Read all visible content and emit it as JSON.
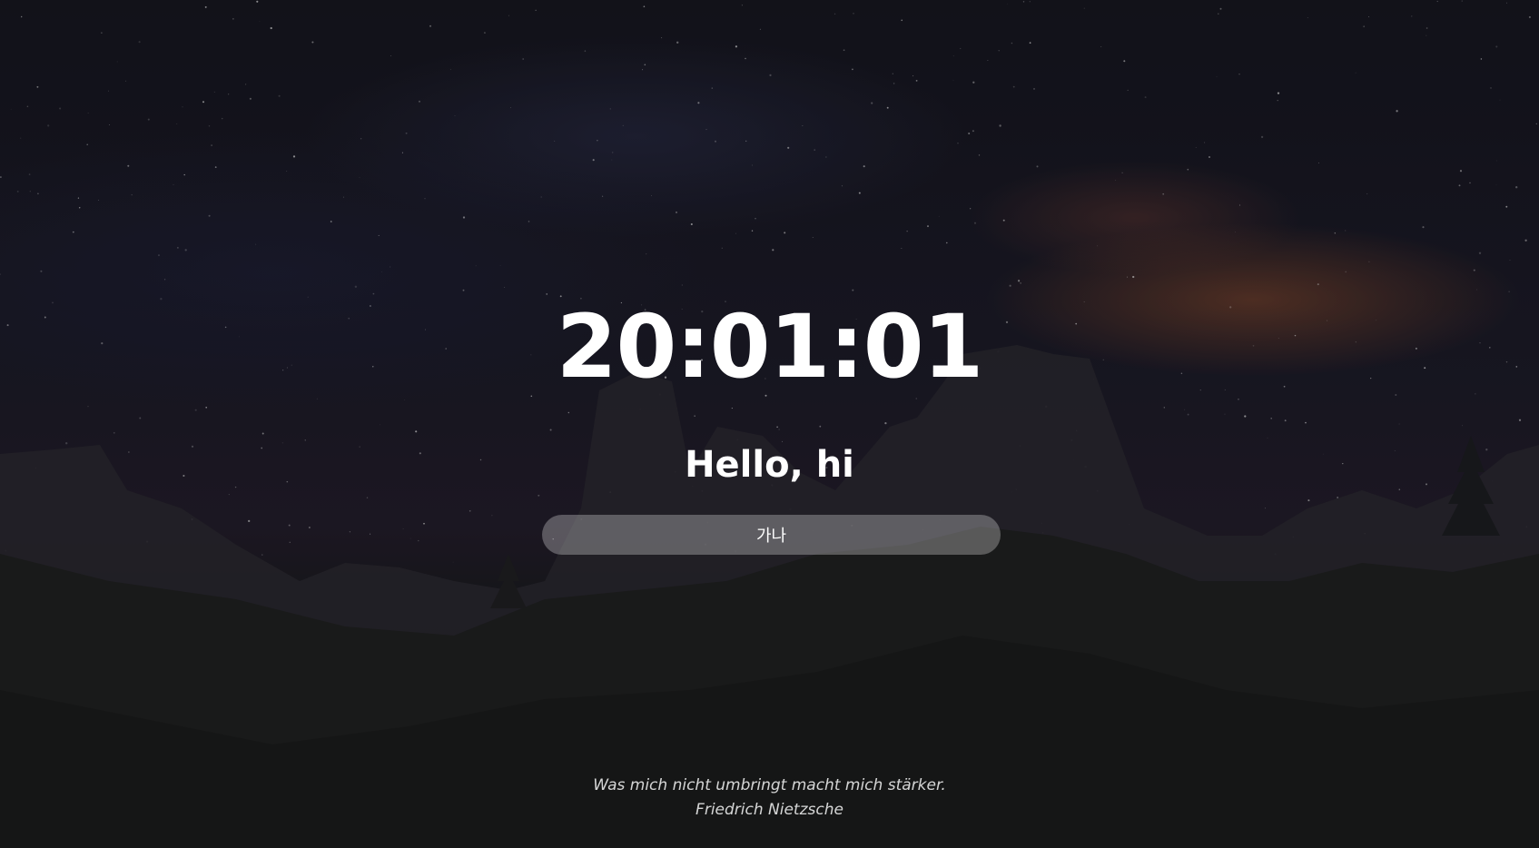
{
  "clock": {
    "time": "20:01:01"
  },
  "greeting": {
    "text": "Hello, hi"
  },
  "todo": {
    "value": "가나",
    "placeholder": ""
  },
  "quote": {
    "text": "Was mich nicht umbringt macht mich stärker.",
    "author": "Friedrich Nietzsche"
  },
  "background": {
    "description_icon": "night-sky-mountain-background",
    "sky_color": "#16161f",
    "milky_way_accent": "#96502d"
  }
}
